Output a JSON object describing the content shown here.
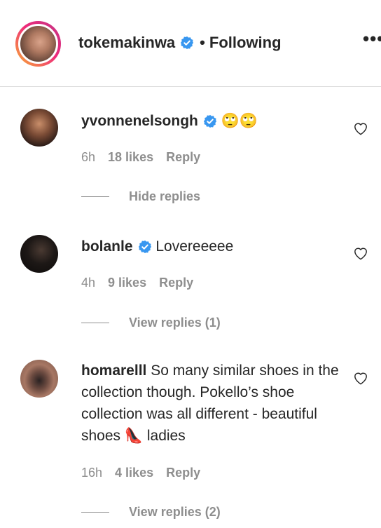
{
  "header": {
    "username": "tokemakinwa",
    "separator": "•",
    "follow_status": "Following",
    "more_icon": "more-horizontal-icon"
  },
  "comments": [
    {
      "username": "yvonnenelsongh",
      "verified": true,
      "text": "🙄🙄",
      "time": "6h",
      "likes": "18 likes",
      "reply": "Reply",
      "replies_toggle": "Hide replies"
    },
    {
      "username": "bolanle",
      "verified": true,
      "text": "Lovereeeee",
      "time": "4h",
      "likes": "9 likes",
      "reply": "Reply",
      "replies_toggle": "View replies (1)"
    },
    {
      "username": "homarelll",
      "verified": false,
      "text": "So many similar shoes in the collection though. Pokello’s shoe collection was all different - beautiful shoes 👠 ladies",
      "time": "16h",
      "likes": "4 likes",
      "reply": "Reply",
      "replies_toggle": "View replies (2)"
    }
  ],
  "colors": {
    "verified_blue": "#3897f0",
    "secondary_text": "#8e8e8e",
    "primary_text": "#262626"
  }
}
